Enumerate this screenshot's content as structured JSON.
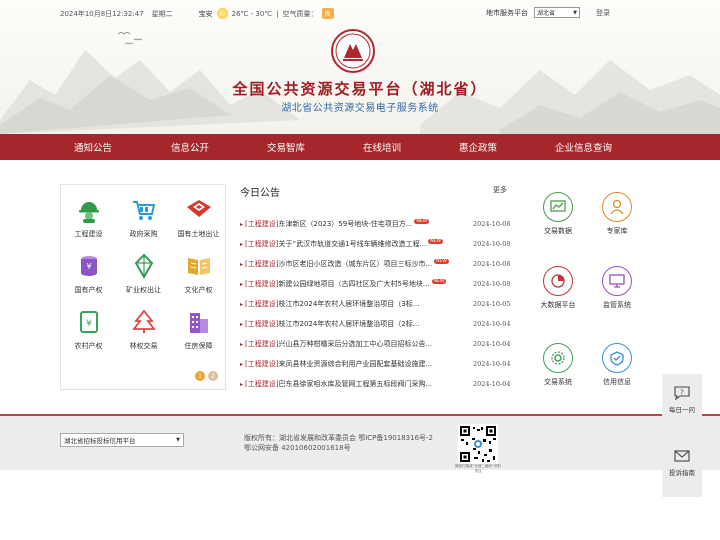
{
  "topbar": {
    "date": "2024年10月8日12:32:47",
    "weekday": "星期二",
    "city": "宝安",
    "temperature": "26℃ - 30℃",
    "air_label": "空气质量：",
    "air_value": "良",
    "region_label": "地市服务平台",
    "region_value": "湖北省",
    "login": "登录"
  },
  "header": {
    "title": "全国公共资源交易平台（湖北省）",
    "subtitle": "湖北省公共资源交易电子服务系统"
  },
  "nav": [
    {
      "label": "通知公告"
    },
    {
      "label": "信息公开"
    },
    {
      "label": "交易智库"
    },
    {
      "label": "在线培训"
    },
    {
      "label": "惠企政策"
    },
    {
      "label": "企业信息查询"
    }
  ],
  "categories": [
    {
      "label": "工程建设",
      "icon": "worker-helmet-icon",
      "color": "#2e9b48"
    },
    {
      "label": "政府采购",
      "icon": "shopping-cart-icon",
      "color": "#2b9ad6"
    },
    {
      "label": "国有土地出让",
      "icon": "land-parcel-icon",
      "color": "#d9362e"
    },
    {
      "label": "国有产权",
      "icon": "coin-stack-icon",
      "color": "#8a55c4"
    },
    {
      "label": "矿业权出让",
      "icon": "mineral-crystal-icon",
      "color": "#3a9a5a"
    },
    {
      "label": "文化产权",
      "icon": "open-book-icon",
      "color": "#e2a82c"
    },
    {
      "label": "农村产权",
      "icon": "rural-document-icon",
      "color": "#3aa55a"
    },
    {
      "label": "林权交易",
      "icon": "forest-tree-icon",
      "color": "#d94a44"
    },
    {
      "label": "住房保障",
      "icon": "building-icon",
      "color": "#9355c9"
    }
  ],
  "pager": [
    "1",
    "2"
  ],
  "news": {
    "title": "今日公告",
    "more": "更多",
    "new_badge": "NEW",
    "items": [
      {
        "tag": "[工程建设]",
        "text": "东津新区（2023）59号地块-住宅项目方...",
        "date": "2024-10-08",
        "new": true
      },
      {
        "tag": "[工程建设]",
        "text": "关于“武汉市轨道交通1号线车辆维修改造工程...",
        "date": "2024-10-08",
        "new": true
      },
      {
        "tag": "[工程建设]",
        "text": "沙市区老旧小区改造（城东片区）项目三标沙市...",
        "date": "2024-10-08",
        "new": true
      },
      {
        "tag": "[工程建设]",
        "text": "新建公园绿地项目（古四社区及广大村5号地块...",
        "date": "2024-10-08",
        "new": true
      },
      {
        "tag": "[工程建设]",
        "text": "枝江市2024年农村人居环境整治项目（3标...",
        "date": "2024-10-05",
        "new": false
      },
      {
        "tag": "[工程建设]",
        "text": "枝江市2024年农村人居环境整治项目（2标...",
        "date": "2024-10-04",
        "new": false
      },
      {
        "tag": "[工程建设]",
        "text": "兴山县万种柑橘采后分选加工中心项目招标公告...",
        "date": "2024-10-04",
        "new": false
      },
      {
        "tag": "[工程建设]",
        "text": "来凤县林业资源综合利用产业园配套基础设施建...",
        "date": "2024-10-04",
        "new": false
      },
      {
        "tag": "[工程建设]",
        "text": "巴东县徐家咀水库及管网工程第五标段阀门采购...",
        "date": "2024-10-04",
        "new": false
      }
    ]
  },
  "systems": [
    {
      "label": "交易数据",
      "icon": "chart-icon",
      "color": "#4a9a4a"
    },
    {
      "label": "专家库",
      "icon": "expert-icon",
      "color": "#e08a2a"
    },
    {
      "label": "大数据平台",
      "icon": "big-data-icon",
      "color": "#c0353a"
    },
    {
      "label": "监管系统",
      "icon": "monitor-icon",
      "color": "#9c4fbf"
    },
    {
      "label": "交易系统",
      "icon": "gear-icon",
      "color": "#3ca05a"
    },
    {
      "label": "信用信息",
      "icon": "credit-icon",
      "color": "#3a8fd0"
    }
  ],
  "float_panel": {
    "faq": "每日一问",
    "guide": "投诉指南"
  },
  "footer": {
    "select_value": "湖北省招标投标信用平台",
    "line1": "版权所有：湖北省发展和改革委员会    鄂ICP备19018316号-2",
    "line2": "鄂公网安备 42010602001618号",
    "qr_caption": "微信扫描或“长按二维码”识别关注"
  }
}
